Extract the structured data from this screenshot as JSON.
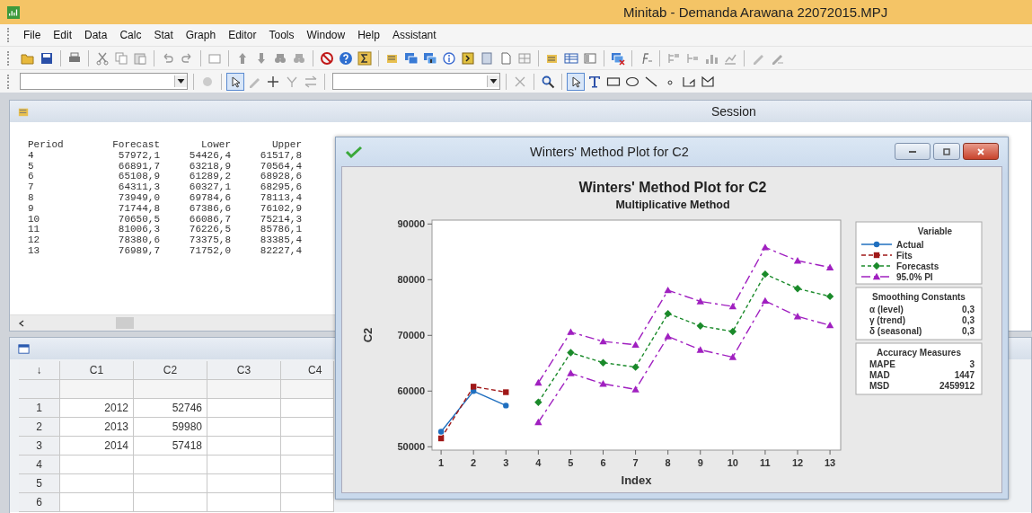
{
  "window": {
    "title": "Minitab - Demanda Arawana 22072015.MPJ"
  },
  "menu": [
    "File",
    "Edit",
    "Data",
    "Calc",
    "Stat",
    "Graph",
    "Editor",
    "Tools",
    "Window",
    "Help",
    "Assistant"
  ],
  "session": {
    "title": "Session",
    "columns": [
      "Period",
      "Forecast",
      "Lower",
      "Upper"
    ],
    "rows": [
      [
        "4",
        "57972,1",
        "54426,4",
        "61517,8"
      ],
      [
        "5",
        "66891,7",
        "63218,9",
        "70564,4"
      ],
      [
        "6",
        "65108,9",
        "61289,2",
        "68928,6"
      ],
      [
        "7",
        "64311,3",
        "60327,1",
        "68295,6"
      ],
      [
        "8",
        "73949,0",
        "69784,6",
        "78113,4"
      ],
      [
        "9",
        "71744,8",
        "67386,6",
        "76102,9"
      ],
      [
        "10",
        "70650,5",
        "66086,7",
        "75214,3"
      ],
      [
        "11",
        "81006,3",
        "76226,5",
        "85786,1"
      ],
      [
        "12",
        "78380,6",
        "73375,8",
        "83385,4"
      ],
      [
        "13",
        "76989,7",
        "71752,0",
        "82227,4"
      ]
    ]
  },
  "worksheet": {
    "corner": "↓",
    "columns": [
      "C1",
      "C2",
      "C3",
      "C4"
    ],
    "rows": [
      {
        "label": "1",
        "cells": [
          "2012",
          "52746",
          "",
          ""
        ]
      },
      {
        "label": "2",
        "cells": [
          "2013",
          "59980",
          "",
          ""
        ]
      },
      {
        "label": "3",
        "cells": [
          "2014",
          "57418",
          "",
          ""
        ]
      },
      {
        "label": "4",
        "cells": [
          "",
          "",
          "",
          ""
        ]
      },
      {
        "label": "5",
        "cells": [
          "",
          "",
          "",
          ""
        ]
      },
      {
        "label": "6",
        "cells": [
          "",
          "",
          "",
          ""
        ]
      }
    ]
  },
  "plot": {
    "window_title": "Winters' Method Plot for C2",
    "subtitle": "Multiplicative Method",
    "chart_data": {
      "type": "line",
      "title": "Winters' Method Plot for C2",
      "xlabel": "Index",
      "ylabel": "C2",
      "legend": {
        "title": "Variable"
      },
      "x": [
        1,
        2,
        3,
        4,
        5,
        6,
        7,
        8,
        9,
        10,
        11,
        12,
        13
      ],
      "xlim": [
        0.72,
        13.33
      ],
      "ylim": [
        49400,
        90700
      ],
      "xticks": [
        {
          "value": 1,
          "label": "1"
        },
        {
          "value": 2,
          "label": "2"
        },
        {
          "value": 3,
          "label": "3"
        },
        {
          "value": 4,
          "label": "4"
        },
        {
          "value": 5,
          "label": "5"
        },
        {
          "value": 6,
          "label": "6"
        },
        {
          "value": 7,
          "label": "7"
        },
        {
          "value": 8,
          "label": "8"
        },
        {
          "value": 9,
          "label": "9"
        },
        {
          "value": 10,
          "label": "10"
        },
        {
          "value": 11,
          "label": "11"
        },
        {
          "value": 12,
          "label": "12"
        },
        {
          "value": 13,
          "label": "13"
        }
      ],
      "yticks": [
        50000,
        60000,
        70000,
        80000,
        90000
      ],
      "series": [
        {
          "name": "Actual",
          "color": "#1f6fbf",
          "line_style": "solid",
          "marker": "circle",
          "values": [
            52700,
            60000,
            57400,
            null,
            null,
            null,
            null,
            null,
            null,
            null,
            null,
            null,
            null
          ]
        },
        {
          "name": "Fits",
          "color": "#a01818",
          "line_style": "dashed",
          "marker": "square",
          "values": [
            51500,
            60800,
            59800,
            null,
            null,
            null,
            null,
            null,
            null,
            null,
            null,
            null,
            null
          ]
        },
        {
          "name": "Forecasts",
          "color": "#1a8a2a",
          "line_style": "dotted",
          "marker": "diamond",
          "values": [
            null,
            null,
            null,
            58000,
            66900,
            65100,
            64300,
            73900,
            71700,
            70700,
            81000,
            78400,
            77000
          ]
        },
        {
          "name": "95.0% PI",
          "color": "#a020c0",
          "line_style": "dashdot",
          "marker": "triangle",
          "values": [
            null,
            null,
            null,
            54400,
            63200,
            61300,
            60300,
            69800,
            67400,
            66100,
            76200,
            73400,
            71800
          ]
        },
        {
          "color": "#a020c0",
          "line_style": "dashdot",
          "marker": "triangle",
          "values": [
            null,
            null,
            null,
            61500,
            70600,
            68900,
            68300,
            78100,
            76100,
            75200,
            85800,
            83400,
            82200
          ]
        }
      ]
    },
    "smoothing": {
      "title": "Smoothing Constants",
      "rows": [
        {
          "label": "α (level)",
          "value": "0,3"
        },
        {
          "label": "γ (trend)",
          "value": "0,3"
        },
        {
          "label": "δ (seasonal)",
          "value": "0,3"
        }
      ]
    },
    "accuracy": {
      "title": "Accuracy Measures",
      "rows": [
        {
          "label": "MAPE",
          "value": "3"
        },
        {
          "label": "MAD",
          "value": "1447"
        },
        {
          "label": "MSD",
          "value": "2459912"
        }
      ]
    }
  }
}
